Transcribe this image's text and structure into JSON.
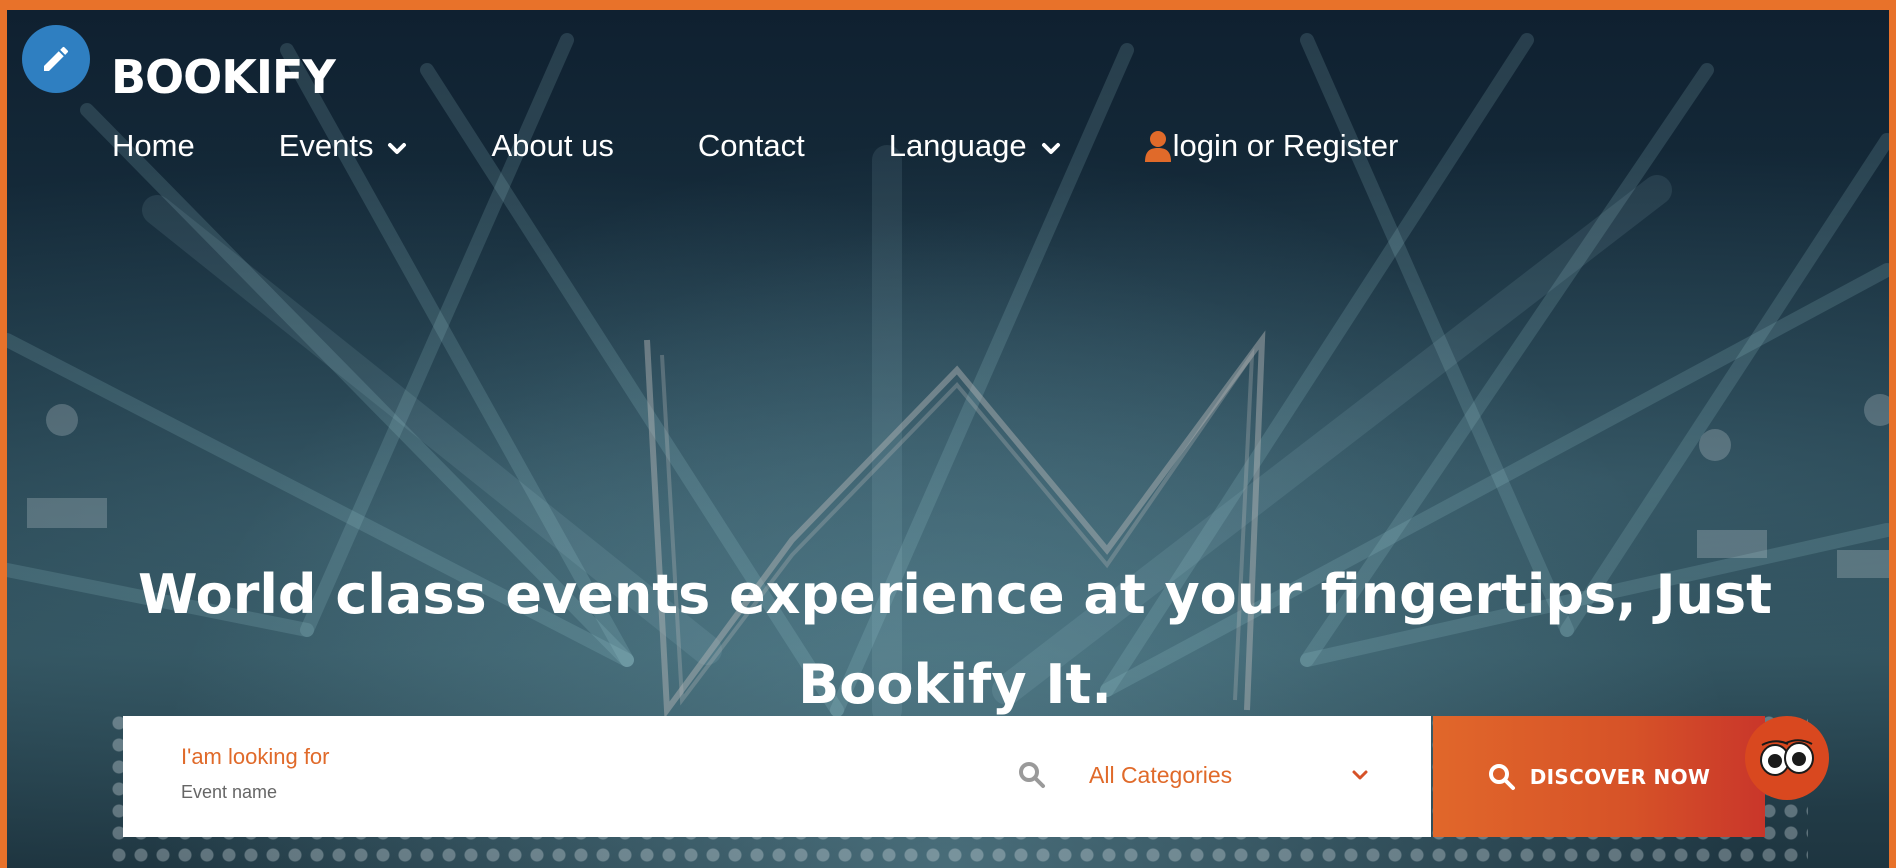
{
  "brand": {
    "logo_text": "BOOKIFY"
  },
  "nav": {
    "items": [
      {
        "label": "Home",
        "dropdown": false
      },
      {
        "label": "Events",
        "dropdown": true
      },
      {
        "label": "About us",
        "dropdown": false
      },
      {
        "label": "Contact",
        "dropdown": false
      },
      {
        "label": "Language",
        "dropdown": true
      }
    ],
    "account_label": "login or Register"
  },
  "hero": {
    "title": "World class events experience at your fingertips, Just Bookify It."
  },
  "search": {
    "label": "I'am looking for",
    "placeholder": "Event name",
    "category_selected": "All Categories",
    "button_label": "DISCOVER NOW"
  },
  "colors": {
    "accent": "#e06a2a",
    "button_gradient_start": "#e1672a",
    "button_gradient_end": "#c9362a",
    "edit_fab": "#2f7fc1",
    "frame_border": "#e8722a"
  },
  "icons": [
    "pencil-icon",
    "chevron-down-icon",
    "user-icon",
    "search-icon",
    "mascot-eyes-icon"
  ]
}
